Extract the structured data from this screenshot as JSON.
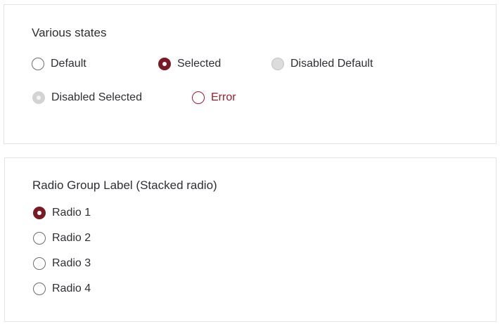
{
  "colors": {
    "accent": "#7a1a24",
    "error": "#a3182a"
  },
  "states_section": {
    "title": "Various states",
    "radios": [
      {
        "label": "Default",
        "state": "default"
      },
      {
        "label": "Selected",
        "state": "selected"
      },
      {
        "label": "Disabled Default",
        "state": "disabled-default"
      },
      {
        "label": "Disabled Selected",
        "state": "disabled-selected"
      },
      {
        "label": "Error",
        "state": "error"
      }
    ]
  },
  "group_section": {
    "title": "Radio Group Label (Stacked radio)",
    "radios": [
      {
        "label": "Radio 1",
        "selected": true
      },
      {
        "label": "Radio 2",
        "selected": false
      },
      {
        "label": "Radio 3",
        "selected": false
      },
      {
        "label": "Radio 4",
        "selected": false
      }
    ]
  }
}
